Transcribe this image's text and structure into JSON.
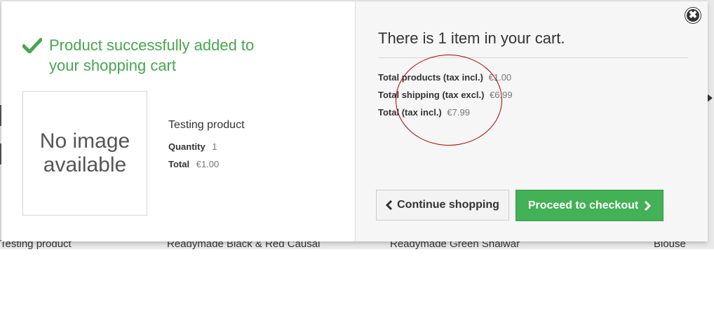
{
  "background": {
    "product_names": [
      "Testing product",
      "Readymade Black & Red Causal",
      "Readymade Green Shalwar",
      "Blouse"
    ]
  },
  "modal": {
    "left": {
      "success_message": "Product successfully added to your shopping cart",
      "image_placeholder": "No image available",
      "product_name": "Testing product",
      "quantity_label": "Quantity",
      "quantity_value": "1",
      "total_label": "Total",
      "total_value": "€1.00"
    },
    "right": {
      "cart_title": "There is 1 item in your cart.",
      "totals": [
        {
          "label": "Total products (tax incl.)",
          "value": "€1.00"
        },
        {
          "label": "Total shipping (tax excl.)",
          "value": "€6.99"
        },
        {
          "label": "Total (tax incl.)",
          "value": "€7.99"
        }
      ],
      "continue_label": "Continue shopping",
      "checkout_label": "Proceed to checkout"
    },
    "close_symbol": "✖",
    "colors": {
      "success": "#46a74e",
      "checkout_button": "#43b155",
      "annotation_ellipse": "#b00000"
    }
  }
}
